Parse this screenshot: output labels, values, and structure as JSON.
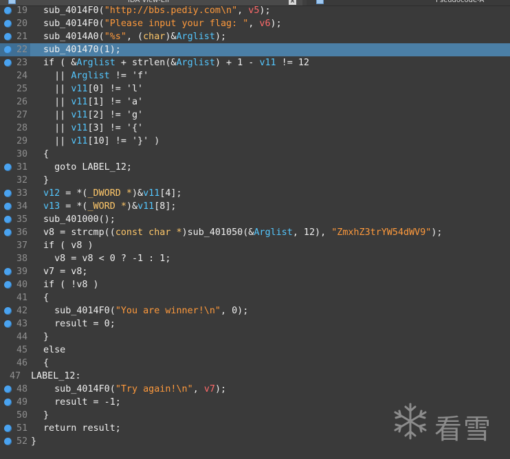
{
  "tabs": {
    "ida_view": "IDA View-EIP",
    "pseudocode": "Pseudocode-A",
    "close_glyph": "×"
  },
  "watermark": {
    "text": "看雪"
  },
  "colors": {
    "background": "#3a3a3a",
    "breakpoint": "#4aa3f0",
    "highlight": "#4b7fa6",
    "string": "#ff9a3c",
    "local_var": "#ff6a6a",
    "global": "#54c7ff",
    "type": "#ffc86a"
  },
  "code": {
    "l19": {
      "num": "19",
      "a": "sub_4014F0(",
      "s": "\"http://bbs.pediy.com\\n\"",
      "b": ", ",
      "v": "v5",
      "c": ");"
    },
    "l20": {
      "num": "20",
      "a": "sub_4014F0(",
      "s": "\"Please input your flag: \"",
      "b": ", ",
      "v": "v6",
      "c": ");"
    },
    "l21": {
      "num": "21",
      "a": "sub_4014A0(",
      "s": "\"%s\"",
      "b": ", (",
      "t": "char",
      "c": ")&",
      "g": "Arglist",
      "d": ");"
    },
    "l22": {
      "num": "22",
      "text": "sub_401470(1);"
    },
    "l23": {
      "num": "23",
      "a": "if ( &",
      "g1": "Arglist",
      "b": " + strlen(&",
      "g2": "Arglist",
      "c": ") + 1 - ",
      "g3": "v11",
      "d": " != 12"
    },
    "l24": {
      "num": "24",
      "a": "  || ",
      "g": "Arglist",
      "b": " != 'f'"
    },
    "l25": {
      "num": "25",
      "a": "  || ",
      "g": "v11",
      "b": "[0] != 'l'"
    },
    "l26": {
      "num": "26",
      "a": "  || ",
      "g": "v11",
      "b": "[1] != 'a'"
    },
    "l27": {
      "num": "27",
      "a": "  || ",
      "g": "v11",
      "b": "[2] != 'g'"
    },
    "l28": {
      "num": "28",
      "a": "  || ",
      "g": "v11",
      "b": "[3] != '{'"
    },
    "l29": {
      "num": "29",
      "a": "  || ",
      "g": "v11",
      "b": "[10] != '}' )"
    },
    "l30": {
      "num": "30",
      "text": "{"
    },
    "l31": {
      "num": "31",
      "text": "  goto LABEL_12;"
    },
    "l32": {
      "num": "32",
      "text": "}"
    },
    "l33": {
      "num": "33",
      "g1": "v12",
      "a": " = *(",
      "t": "_DWORD *",
      "b": ")&",
      "g2": "v11",
      "c": "[4];"
    },
    "l34": {
      "num": "34",
      "g1": "v13",
      "a": " = *(",
      "t": "_WORD *",
      "b": ")&",
      "g2": "v11",
      "c": "[8];"
    },
    "l35": {
      "num": "35",
      "text": "sub_401000();"
    },
    "l36": {
      "num": "36",
      "a": "v8 = strcmp((",
      "t": "const char *",
      "b": ")sub_401050(&",
      "g": "Arglist",
      "c": ", 12), ",
      "s": "\"ZmxhZ3trYW54dWV9\"",
      "d": ");"
    },
    "l37": {
      "num": "37",
      "text": "if ( v8 )"
    },
    "l38": {
      "num": "38",
      "text": "  v8 = v8 < 0 ? -1 : 1;"
    },
    "l39": {
      "num": "39",
      "text": "v7 = v8;"
    },
    "l40": {
      "num": "40",
      "text": "if ( !v8 )"
    },
    "l41": {
      "num": "41",
      "text": "{"
    },
    "l42": {
      "num": "42",
      "a": "  sub_4014F0(",
      "s": "\"You are winner!\\n\"",
      "b": ", 0);"
    },
    "l43": {
      "num": "43",
      "text": "  result = 0;"
    },
    "l44": {
      "num": "44",
      "text": "}"
    },
    "l45": {
      "num": "45",
      "text": "else"
    },
    "l46": {
      "num": "46",
      "text": "{"
    },
    "l47": {
      "num": "47",
      "text": "LABEL_12:"
    },
    "l48": {
      "num": "48",
      "a": "  sub_4014F0(",
      "s": "\"Try again!\\n\"",
      "b": ", ",
      "v": "v7",
      "c": ");"
    },
    "l49": {
      "num": "49",
      "text": "  result = -1;"
    },
    "l50": {
      "num": "50",
      "text": "}"
    },
    "l51": {
      "num": "51",
      "text": "return result;"
    },
    "l52": {
      "num": "52",
      "text": "}"
    }
  }
}
